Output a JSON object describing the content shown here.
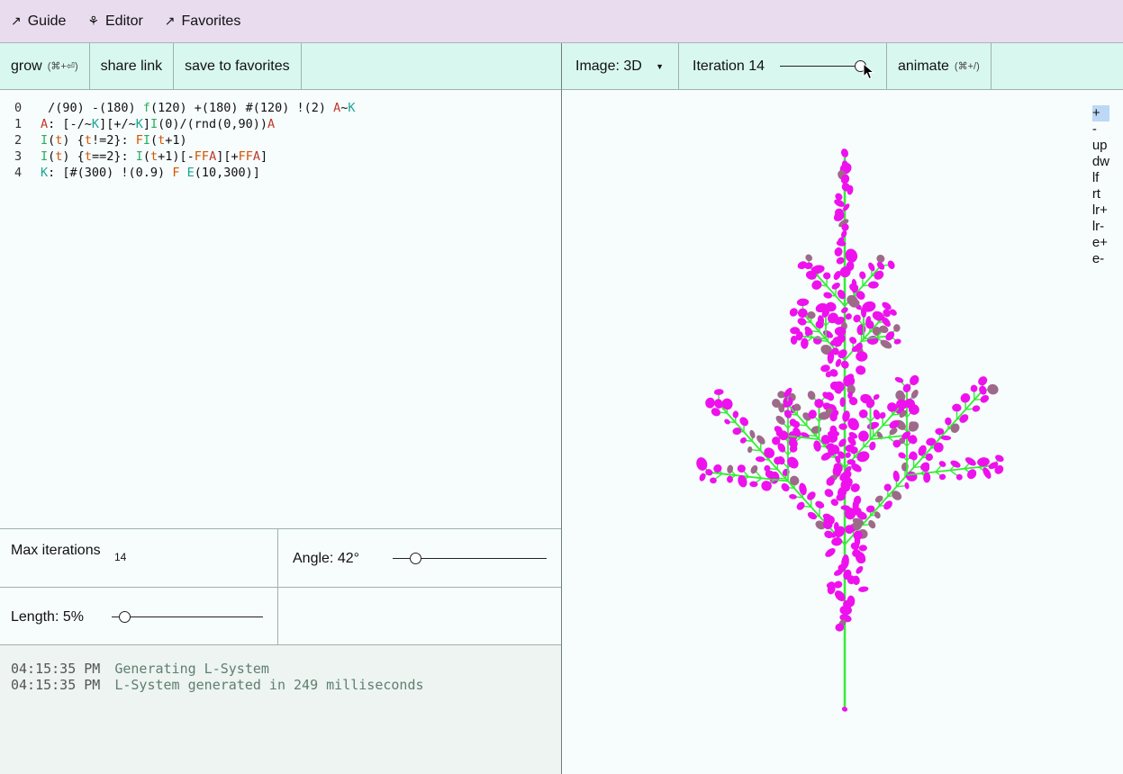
{
  "nav": {
    "guide": {
      "icon": "↗",
      "label": "Guide"
    },
    "editor": {
      "icon": "⚘",
      "label": "Editor"
    },
    "favorites": {
      "icon": "↗",
      "label": "Favorites"
    }
  },
  "toolbar": {
    "grow_label": "grow",
    "grow_shortcut": "(⌘+⏎)",
    "share_label": "share link",
    "save_label": "save to favorites",
    "image_select": "Image: 3D",
    "iteration_label": "Iteration 14",
    "iteration_value": 14,
    "iteration_max": 14,
    "animate_label": "animate",
    "animate_shortcut": "(⌘+/)"
  },
  "code": {
    "lines": [
      {
        "n": "0",
        "tokens": [
          [
            "",
            " /(90) -(180) "
          ],
          [
            "g",
            "f"
          ],
          [
            "",
            "(120) +(180) #(120) !(2) "
          ],
          [
            "r",
            "A"
          ],
          [
            "",
            "~"
          ],
          [
            "t",
            "K"
          ]
        ]
      },
      {
        "n": "1",
        "tokens": [
          [
            "r",
            "A"
          ],
          [
            "",
            ": [-/~"
          ],
          [
            "t",
            "K"
          ],
          [
            "",
            "][+/~"
          ],
          [
            "t",
            "K"
          ],
          [
            "",
            "]"
          ],
          [
            "g",
            "I"
          ],
          [
            "",
            "(0)/(rnd(0,90))"
          ],
          [
            "r",
            "A"
          ]
        ]
      },
      {
        "n": "2",
        "tokens": [
          [
            "g",
            "I"
          ],
          [
            "",
            "("
          ],
          [
            "o",
            "t"
          ],
          [
            "",
            ") {"
          ],
          [
            "o",
            "t"
          ],
          [
            "",
            "!=2}: "
          ],
          [
            "o",
            "F"
          ],
          [
            "g",
            "I"
          ],
          [
            "",
            "("
          ],
          [
            "o",
            "t"
          ],
          [
            "",
            "+1)"
          ]
        ]
      },
      {
        "n": "3",
        "tokens": [
          [
            "g",
            "I"
          ],
          [
            "",
            "("
          ],
          [
            "o",
            "t"
          ],
          [
            "",
            ") {"
          ],
          [
            "o",
            "t"
          ],
          [
            "",
            "==2}: "
          ],
          [
            "g",
            "I"
          ],
          [
            "",
            "("
          ],
          [
            "o",
            "t"
          ],
          [
            "",
            "+1)[-"
          ],
          [
            "o",
            "FF"
          ],
          [
            "r",
            "A"
          ],
          [
            "",
            "][+"
          ],
          [
            "o",
            "FF"
          ],
          [
            "r",
            "A"
          ],
          [
            "",
            "]"
          ]
        ]
      },
      {
        "n": "4",
        "tokens": [
          [
            "t",
            "K"
          ],
          [
            "",
            ": [#(300) !(0.9) "
          ],
          [
            "o",
            "F"
          ],
          [
            "",
            " "
          ],
          [
            "t",
            "E"
          ],
          [
            "",
            "(10,300)]"
          ]
        ]
      }
    ]
  },
  "params": {
    "max_iterations_label": "Max iterations",
    "max_iterations_value": "14",
    "angle_label": "Angle: 42°",
    "angle_fraction": 0.12,
    "length_label": "Length: 5%",
    "length_fraction": 0.05
  },
  "console": [
    {
      "time": "04:15:35 PM",
      "msg": "Generating L-System"
    },
    {
      "time": "04:15:35 PM",
      "msg": "L-System generated in 249 milliseconds"
    }
  ],
  "view_controls": [
    "+",
    "-",
    "up",
    "dw",
    "lf",
    "rt",
    "lr+",
    "lr-",
    "e+",
    "e-"
  ],
  "colors": {
    "stem": "#33ee33",
    "flower": "#ee11ee",
    "leaf": "#9e6a8a"
  }
}
